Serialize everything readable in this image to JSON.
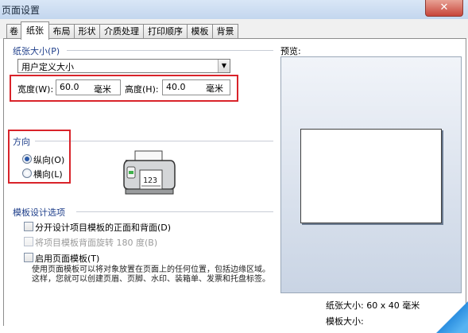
{
  "window": {
    "title": "页面设置",
    "close_label": "✕"
  },
  "tabs": [
    {
      "label": "卷",
      "active": false
    },
    {
      "label": "纸张",
      "active": true
    },
    {
      "label": "布局",
      "active": false
    },
    {
      "label": "形状",
      "active": false
    },
    {
      "label": "介质处理",
      "active": false
    },
    {
      "label": "打印顺序",
      "active": false
    },
    {
      "label": "模板",
      "active": false
    },
    {
      "label": "背景",
      "active": false
    }
  ],
  "paper_size": {
    "group_label": "纸张大小(P)",
    "selected": "用户定义大小",
    "dropdown_icon": "▼",
    "width_label": "宽度(W):",
    "width_value": "60.0",
    "width_unit": "毫米",
    "height_label": "高度(H):",
    "height_value": "40.0",
    "height_unit": "毫米"
  },
  "orientation": {
    "group_label": "方向",
    "portrait_label": "纵向(O)",
    "portrait_selected": true,
    "landscape_label": "横向(L)",
    "landscape_selected": false
  },
  "template_options": {
    "group_label": "模板设计选项",
    "opt1_label": "分开设计项目模板的正面和背面(D)",
    "opt1_checked": false,
    "opt2_label": "将项目模板背面旋转 180 度(B)",
    "opt2_enabled": false,
    "opt3_label": "启用页面模板(T)",
    "opt3_checked": false,
    "description": "使用页面模板可以将对象放置在页面上的任何位置，包括边缘区域。这样，您就可以创建页眉、页脚、水印、装箱单、发票和托盘标签。"
  },
  "preview": {
    "label": "预览:",
    "size_text": "纸张大小: 60 x 40 毫米",
    "template_text": "模板大小: "
  },
  "colors": {
    "highlight": "#d9232a",
    "group_title": "#1e3e8a"
  },
  "icons": {
    "printer": "printer-icon"
  }
}
